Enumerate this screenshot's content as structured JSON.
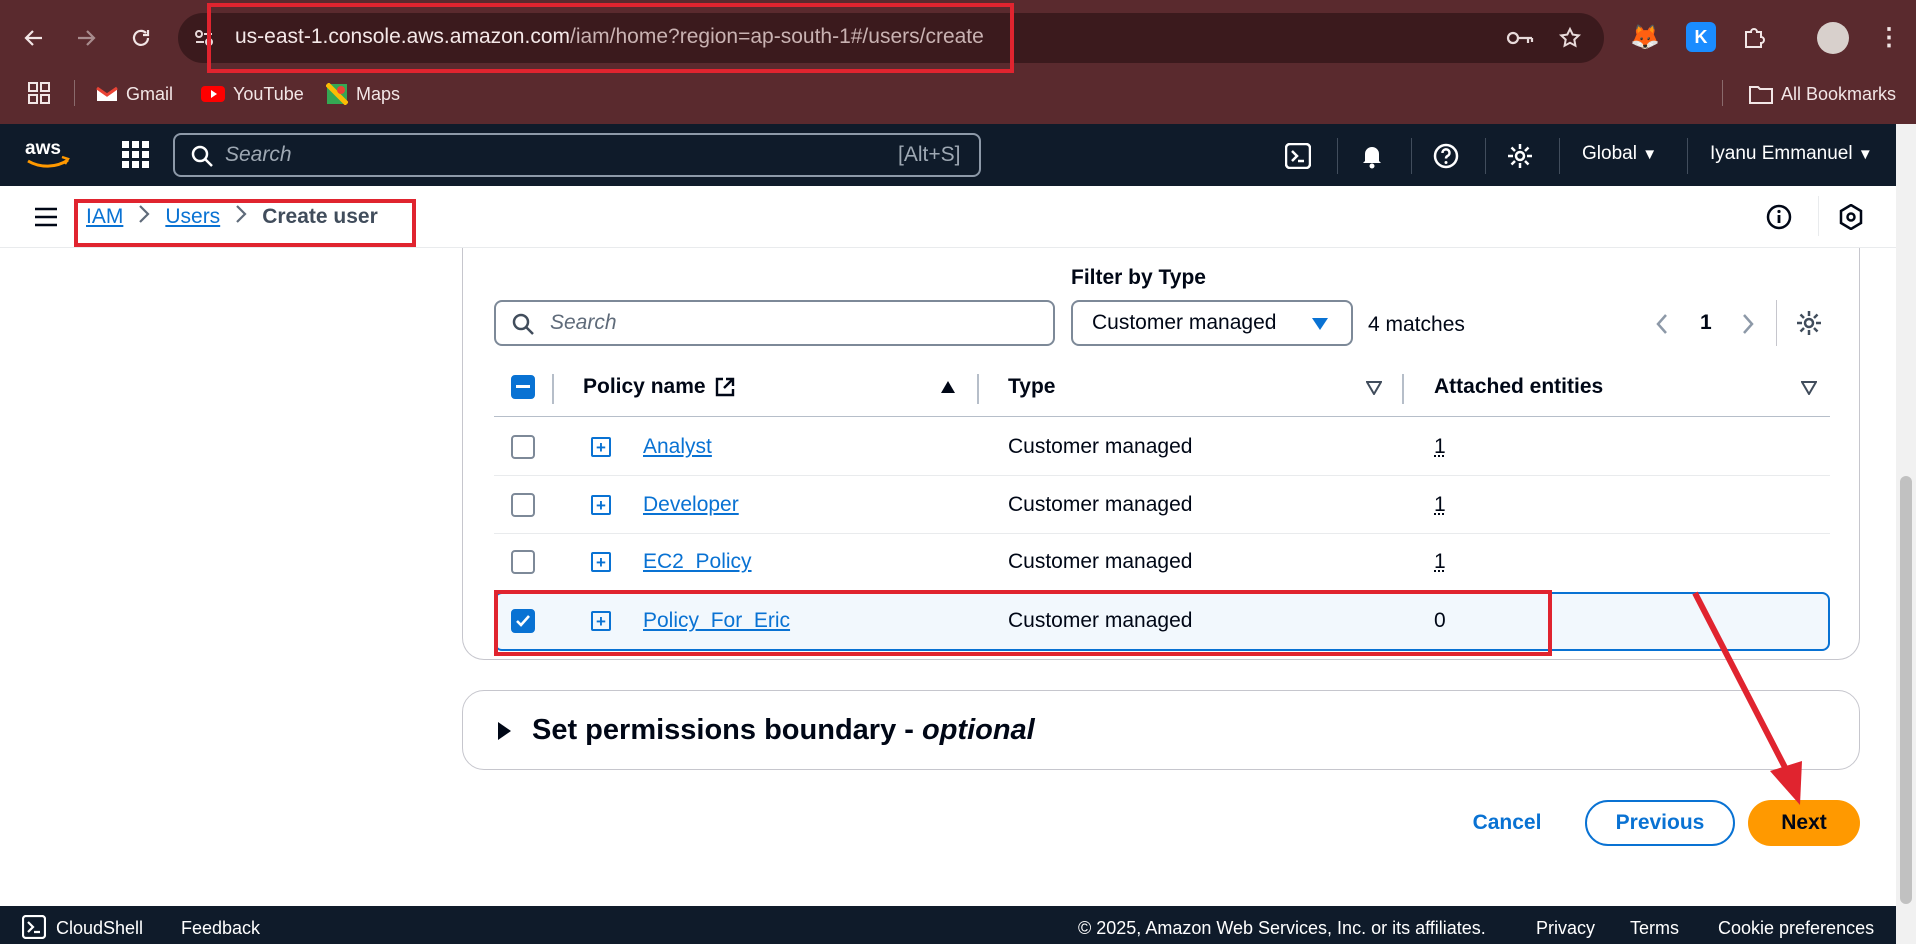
{
  "browser": {
    "url_host": "us-east-1.console.aws.amazon.com",
    "url_path": "/iam/home?region=ap-south-1#/users/create",
    "bookmarks": [
      {
        "label": "Gmail",
        "icon": "gmail-icon"
      },
      {
        "label": "YouTube",
        "icon": "youtube-icon"
      },
      {
        "label": "Maps",
        "icon": "maps-icon"
      }
    ],
    "all_bookmarks": "All Bookmarks",
    "extension_k": "K"
  },
  "aws_header": {
    "search_placeholder": "Search",
    "search_shortcut": "[Alt+S]",
    "region": "Global",
    "user": "Iyanu Emmanuel"
  },
  "breadcrumb": {
    "items": [
      "IAM",
      "Users"
    ],
    "current": "Create user"
  },
  "policies": {
    "filter_label": "Filter by Type",
    "search_placeholder": "Search",
    "type_value": "Customer managed",
    "matches": "4 matches",
    "page": "1",
    "columns": {
      "name": "Policy name",
      "type": "Type",
      "entities": "Attached entities"
    },
    "rows": [
      {
        "name": "Analyst",
        "type": "Customer managed",
        "entities": "1",
        "checked": false
      },
      {
        "name": "Developer",
        "type": "Customer managed",
        "entities": "1",
        "checked": false
      },
      {
        "name": "EC2_Policy",
        "type": "Customer managed",
        "entities": "1",
        "checked": false
      },
      {
        "name": "Policy_For_Eric",
        "type": "Customer managed",
        "entities": "0",
        "checked": true
      }
    ]
  },
  "boundary": {
    "title": "Set permissions boundary - ",
    "title_optional": "optional"
  },
  "actions": {
    "cancel": "Cancel",
    "previous": "Previous",
    "next": "Next"
  },
  "footer": {
    "cloudshell": "CloudShell",
    "feedback": "Feedback",
    "copyright": "© 2025, Amazon Web Services, Inc. or its affiliates.",
    "privacy": "Privacy",
    "terms": "Terms",
    "cookie": "Cookie preferences"
  },
  "colors": {
    "aws_nav": "#0f1b2a",
    "link": "#0972d3",
    "primary_button": "#ff9900",
    "annotation": "#e0242f",
    "browser_frame": "#5a2a2e"
  }
}
